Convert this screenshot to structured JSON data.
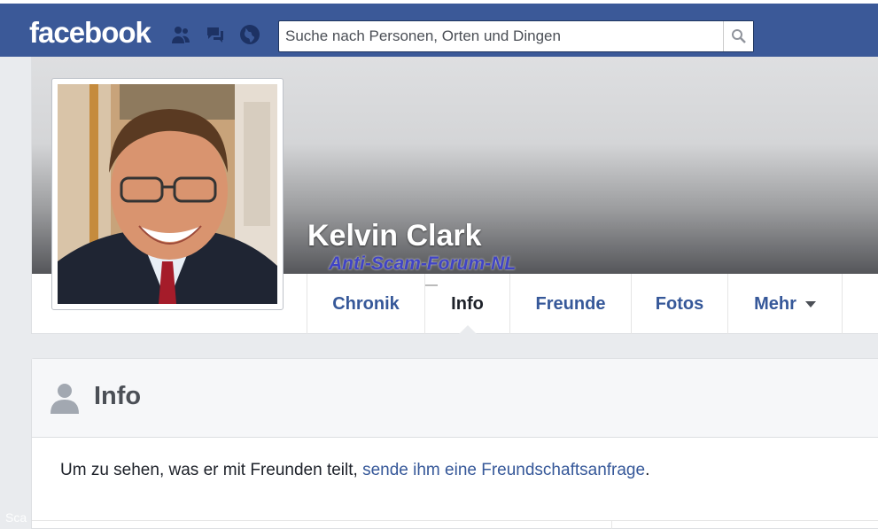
{
  "header": {
    "logo": "facebook",
    "search_placeholder": "Suche nach Personen, Orten und Dingen",
    "brand_color": "#3b5998",
    "jewels": [
      "friend-requests-icon",
      "messages-icon",
      "notifications-globe-icon"
    ]
  },
  "profile": {
    "name": "Kelvin Clark",
    "watermark": "Anti-Scam-Forum-NL"
  },
  "tabs": [
    {
      "label": "Chronik",
      "active": false
    },
    {
      "label": "Info",
      "active": true
    },
    {
      "label": "Freunde",
      "active": false
    },
    {
      "label": "Fotos",
      "active": false
    },
    {
      "label": "Mehr",
      "active": false,
      "has_dropdown": true
    }
  ],
  "info_card": {
    "title": "Info",
    "message_prefix": "Um zu sehen, was er mit Freunden teilt, ",
    "message_link": "sende ihm eine Freundschaftsanfrage",
    "message_suffix": "."
  },
  "corner_text": "Sca"
}
